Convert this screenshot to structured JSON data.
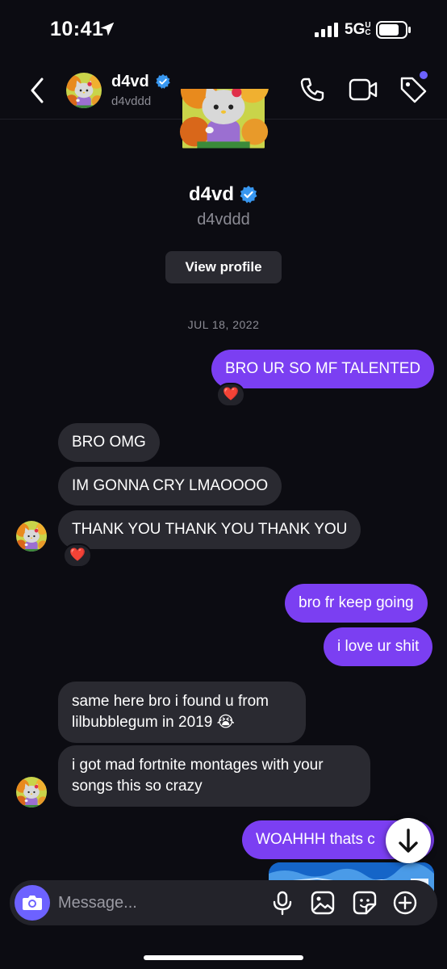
{
  "status_bar": {
    "time": "10:41",
    "network": "5G",
    "network_suffix": "UC"
  },
  "header": {
    "name": "d4vd",
    "username": "d4vddd",
    "icons": [
      "back-chevron-icon",
      "phone-icon",
      "video-icon",
      "tag-icon",
      "verified-badge-icon"
    ]
  },
  "profile": {
    "name": "d4vd",
    "username": "d4vddd",
    "view_profile_label": "View profile"
  },
  "date_divider": "JUL 18, 2022",
  "messages": [
    {
      "from": "me",
      "text": "BRO UR SO MF TALENTED",
      "reaction": "❤️"
    },
    {
      "from": "them",
      "text": "BRO OMG"
    },
    {
      "from": "them",
      "text": "IM GONNA CRY LMAOOOO"
    },
    {
      "from": "them",
      "text": "THANK YOU THANK YOU THANK YOU",
      "reaction": "❤️"
    },
    {
      "from": "me",
      "text": "bro fr keep going"
    },
    {
      "from": "me",
      "text": "i love ur shit"
    },
    {
      "from": "them",
      "text": "same here bro i found u from lilbubblegum in 2019 😭"
    },
    {
      "from": "them",
      "text": "i got mad fortnite montages with your songs this so crazy"
    },
    {
      "from": "me",
      "text": "WOAHHH thats c"
    }
  ],
  "composer": {
    "placeholder": "Message...",
    "icons": [
      "camera-icon",
      "microphone-icon",
      "gallery-icon",
      "sticker-icon",
      "add-icon"
    ]
  },
  "colors": {
    "background": "#0c0c12",
    "sent_bubble": "#7b3ff2",
    "received_bubble": "#2a2a31",
    "accent": "#6d62ff",
    "verified": "#3897f0"
  }
}
